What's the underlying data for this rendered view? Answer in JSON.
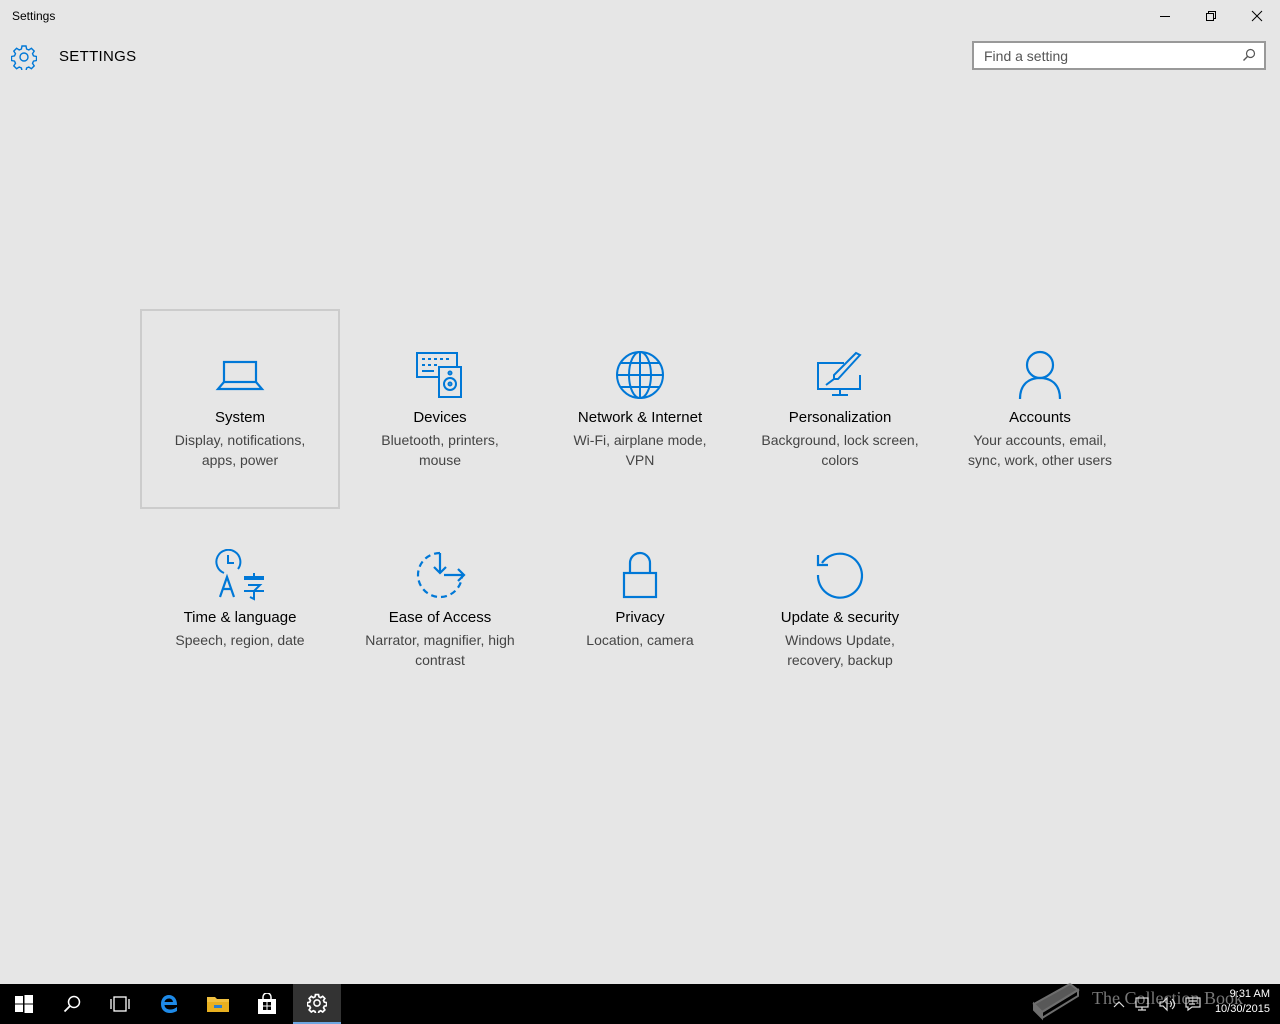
{
  "window": {
    "title": "Settings",
    "controls": [
      "minimize",
      "restore",
      "close"
    ]
  },
  "header": {
    "icon": "gear-icon",
    "title": "SETTINGS"
  },
  "search": {
    "placeholder": "Find a setting",
    "value": ""
  },
  "accent_color": "#0078d7",
  "categories": [
    {
      "label": "System",
      "description": "Display, notifications, apps, power",
      "icon": "laptop-icon",
      "selected": true
    },
    {
      "label": "Devices",
      "description": "Bluetooth, printers, mouse",
      "icon": "devices-icon"
    },
    {
      "label": "Network & Internet",
      "description": "Wi-Fi, airplane mode, VPN",
      "icon": "globe-icon"
    },
    {
      "label": "Personalization",
      "description": "Background, lock screen, colors",
      "icon": "personalization-icon"
    },
    {
      "label": "Accounts",
      "description": "Your accounts, email, sync, work, other users",
      "icon": "person-icon"
    },
    {
      "label": "Time & language",
      "description": "Speech, region, date",
      "icon": "time-language-icon"
    },
    {
      "label": "Ease of Access",
      "description": "Narrator, magnifier, high contrast",
      "icon": "ease-of-access-icon"
    },
    {
      "label": "Privacy",
      "description": "Location, camera",
      "icon": "lock-icon"
    },
    {
      "label": "Update & security",
      "description": "Windows Update, recovery, backup",
      "icon": "update-icon"
    }
  ],
  "taskbar": {
    "items": [
      "start-icon",
      "search-icon",
      "task-view-icon",
      "edge-icon",
      "file-explorer-icon",
      "store-icon",
      "settings-icon"
    ],
    "active_item": "settings-icon",
    "watermark": "The Collection Book",
    "time": "9:31 AM",
    "date": "10/30/2015"
  }
}
